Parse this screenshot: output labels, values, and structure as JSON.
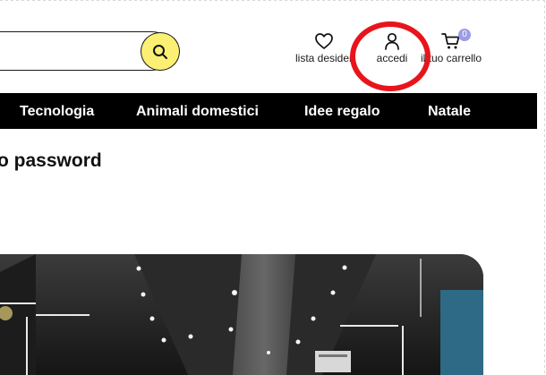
{
  "header": {
    "search": {
      "value": "",
      "placeholder": ""
    },
    "wishlist_label": "lista desider",
    "account_label": "accedi",
    "cart_label": "il tuo carrello",
    "cart_count": "0"
  },
  "nav": {
    "items": [
      {
        "label": "Tecnologia"
      },
      {
        "label": "Animali domestici"
      },
      {
        "label": "Idee regalo"
      },
      {
        "label": "Natale"
      }
    ]
  },
  "main": {
    "title": "o password"
  },
  "colors": {
    "search_button": "#fbf073",
    "highlight_circle": "#e8141c",
    "cart_badge": "#9b9be6",
    "nav_background": "#000000"
  },
  "icons": {
    "search": "search-icon",
    "wishlist": "heart-icon",
    "account": "user-icon",
    "cart": "cart-icon"
  }
}
